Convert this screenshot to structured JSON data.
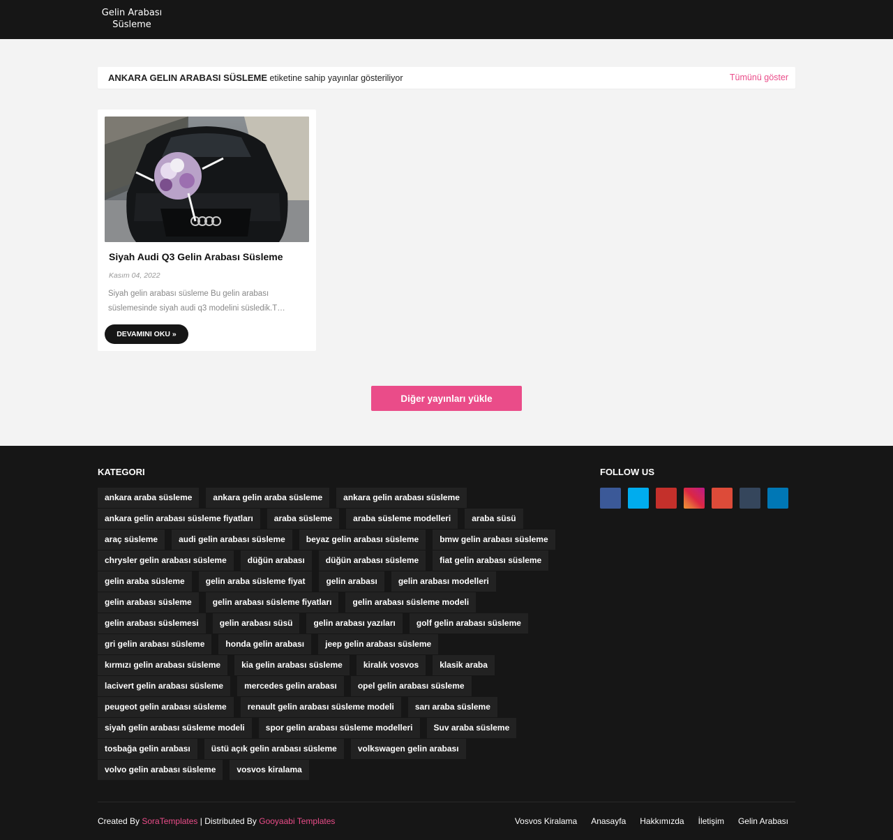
{
  "header": {
    "logo_line1": "Gelin Arabası",
    "logo_line2": "Süsleme"
  },
  "label_bar": {
    "label_name": "ANKARA GELIN ARABASI SÜSLEME",
    "label_suffix": " etiketine sahip yayınlar gösteriliyor",
    "show_all": "Tümünü göster"
  },
  "post": {
    "title": "Siyah Audi Q3 Gelin Arabası Süsleme",
    "date": "Kasım 04, 2022",
    "snippet": "Siyah gelin arabası süsleme Bu gelin arabası süslemesinde siyah audi q3 modelini süsledik.T…",
    "read_more": "DEVAMINI OKU »"
  },
  "load_more": "Diğer yayınları yükle",
  "footer": {
    "categories_title": "KATEGORI",
    "follow_title": "FOLLOW US",
    "tags": [
      "ankara araba süsleme",
      "ankara gelin araba süsleme",
      "ankara gelin arabası süsleme",
      "ankara gelin arabası süsleme fiyatları",
      "araba süsleme",
      "araba süsleme modelleri",
      "araba süsü",
      "araç süsleme",
      "audi gelin arabası süsleme",
      "beyaz gelin arabası süsleme",
      "bmw gelin arabası süsleme",
      "chrysler gelin arabası süsleme",
      "düğün arabası",
      "düğün arabası süsleme",
      "fiat gelin arabası süsleme",
      "gelin araba süsleme",
      "gelin araba süsleme fiyat",
      "gelin arabası",
      "gelin arabası modelleri",
      "gelin arabası süsleme",
      "gelin arabası süsleme fiyatları",
      "gelin arabası süsleme modeli",
      "gelin arabası süslemesi",
      "gelin arabası süsü",
      "gelin arabası yazıları",
      "golf gelin arabası süsleme",
      "gri gelin arabası süsleme",
      "honda gelin arabası",
      "jeep gelin arabası süsleme",
      "kırmızı gelin arabası süsleme",
      "kia gelin arabası süsleme",
      "kiralık vosvos",
      "klasik araba",
      "lacivert gelin arabası süsleme",
      "mercedes gelin arabası",
      "opel gelin arabası süsleme",
      "peugeot gelin arabası süsleme",
      "renault gelin arabası süsleme modeli",
      "sarı araba süsleme",
      "siyah gelin arabası süsleme modeli",
      "spor gelin arabası süsleme modelleri",
      "Suv araba süsleme",
      "tosbağa gelin arabası",
      "üstü açık gelin arabası süsleme",
      "volkswagen gelin arabası",
      "volvo gelin arabası süsleme",
      "vosvos kiralama"
    ],
    "socials": [
      {
        "icon": "facebook-icon",
        "color": "#3b5998"
      },
      {
        "icon": "twitter-icon",
        "color": "#00acee"
      },
      {
        "icon": "youtube-icon",
        "color": "#c4302b"
      },
      {
        "icon": "instagram-icon",
        "color": "#d6249f"
      },
      {
        "icon": "google-plus-icon",
        "color": "#dd4b39"
      },
      {
        "icon": "tumblr-icon",
        "color": "#35465c"
      },
      {
        "icon": "linkedin-icon",
        "color": "#0077b5"
      }
    ],
    "credits": {
      "created_by": "Created By ",
      "author": "SoraTemplates",
      "distributed_by": " | Distributed By ",
      "distributor": "Gooyaabi Templates"
    },
    "menu": [
      "Vosvos Kiralama",
      "Anasayfa",
      "Hakkımızda",
      "İletişim",
      "Gelin Arabası"
    ]
  }
}
